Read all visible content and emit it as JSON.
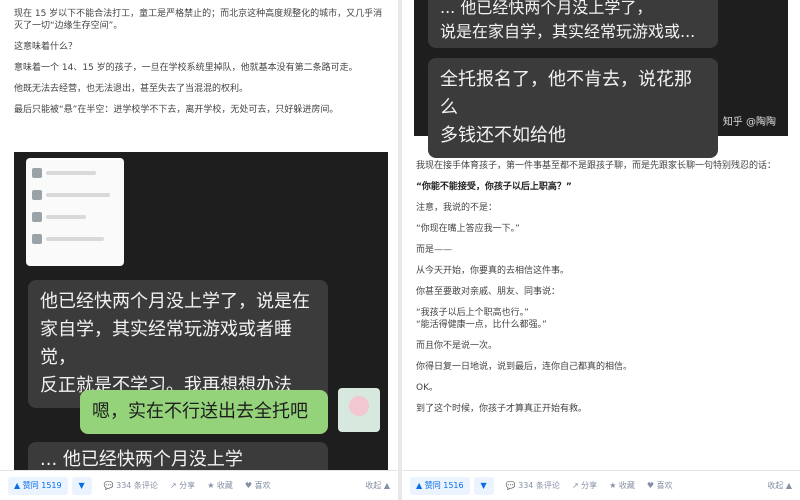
{
  "left": {
    "paragraphs": [
      "现在 15 岁以下不能合法打工，童工是严格禁止的；而北京这种高度规整化的城市，又几乎消灭了一切“边缘生存空间”。",
      "这意味着什么？",
      "意味着一个 14、15 岁的孩子，一旦在学校系统里掉队，他就基本没有第二条路可走。",
      "他既无法去经营，也无法退出，甚至失去了当混混的权利。",
      "最后只能被“悬”在半空：进学校学不下去，离开学校，无处可去，只好躲进房间。"
    ],
    "chat": {
      "bubble1": [
        "他已经快两个月没上学了，说是在",
        "家自学，其实经常玩游戏或者睡觉，",
        "反正就是不学习。我再想想办法"
      ],
      "bubble2": "嗯，实在不行送出去全托吧",
      "bubble3": "... 他已经快两个月没上学"
    },
    "actions": {
      "vote_label": "▲ 赞同 1519",
      "down": "▼",
      "comments": "💬 334 条评论",
      "share": "↗ 分享",
      "favorite": "★ 收藏",
      "like": "♥ 喜欢",
      "collapse": "收起 ▲"
    }
  },
  "right": {
    "chat": {
      "bubble_top": [
        "... 他已经快两个月没上学了，",
        "说是在家自学，其实经常玩游戏或..."
      ],
      "bubble_main": [
        "全托报名了，他不肯去，说花那么",
        "多钱还不如给他"
      ],
      "watermark": "知乎 @陶陶"
    },
    "paragraphs": [
      {
        "text": "我现在接手体育孩子，第一件事基至都不是跟孩子聊，而是先跟家长聊一句特别残忍的话：",
        "bold": false
      },
      {
        "text": "“你能不能接受，你孩子以后上职高？”",
        "bold": true
      },
      {
        "text": "注意，我说的不是：",
        "bold": false
      },
      {
        "text": "“你现在嘴上答应我一下。”",
        "bold": false
      },
      {
        "text": "而是——",
        "bold": false
      },
      {
        "text": "从今天开始，你要真的去相信这件事。",
        "bold": false
      },
      {
        "text": "你甚至要敢对亲戚、朋友、同事说：",
        "bold": false
      },
      {
        "text": "“我孩子以后上个职高也行。”\n“能活得健康一点，比什么都强。”",
        "bold": false
      },
      {
        "text": "而且你不是说一次。",
        "bold": false
      },
      {
        "text": "你得日复一日地说，说到最后，连你自己都真的相信。",
        "bold": false
      },
      {
        "text": "OK。",
        "bold": false
      },
      {
        "text": "到了这个时候，你孩子才算真正开始有救。",
        "bold": false
      }
    ],
    "actions": {
      "vote_label": "▲ 赞同 1516",
      "down": "▼",
      "comments": "💬 334 条评论",
      "share": "↗ 分享",
      "favorite": "★ 收藏",
      "like": "♥ 喜欢",
      "collapse": "收起 ▲"
    }
  }
}
